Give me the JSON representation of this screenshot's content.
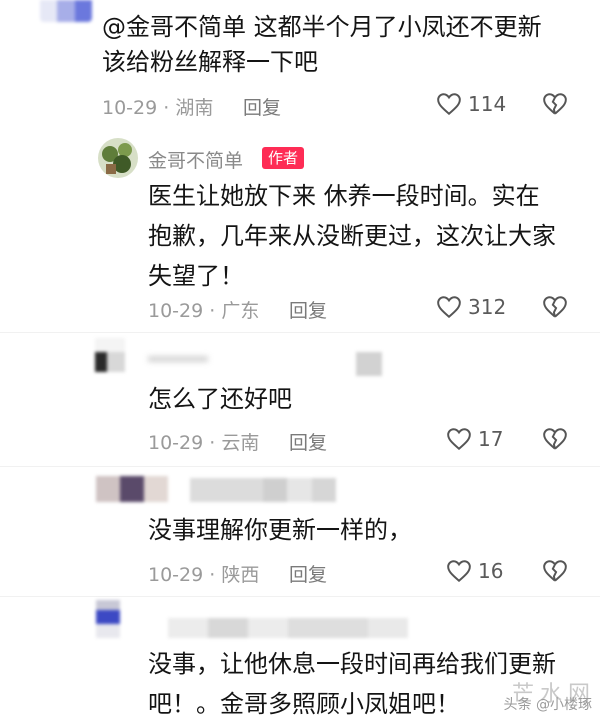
{
  "comments": [
    {
      "text_lines": [
        "@金哥不简单 这都半个月了小凤还不更新",
        "该给粉丝解释一下吧"
      ],
      "date": "10-29 · 湖南",
      "reply_label": "回复",
      "likes": "114"
    },
    {
      "nickname": "金哥不简单",
      "author_tag": "作者",
      "text_lines": [
        "医生让她放下来 休养一段时间。实在",
        "抱歉，几年来从没断更过，这次让大家",
        "失望了！"
      ],
      "date": "10-29 · 广东",
      "reply_label": "回复",
      "likes": "312"
    },
    {
      "text_lines": [
        "怎么了还好吧"
      ],
      "date": "10-29 · 云南",
      "reply_label": "回复",
      "likes": "17"
    },
    {
      "text_lines": [
        "没事理解你更新一样的，"
      ],
      "date": "10-29 · 陕西",
      "reply_label": "回复",
      "likes": "16"
    },
    {
      "text_lines": [
        "没事，让他休息一段时间再给我们更新",
        "吧！。金哥多照顾小凤姐吧！"
      ]
    }
  ],
  "watermark": "头条 @小楼琢",
  "site_logo": "芒水网",
  "icons": {
    "like": "heart-outline-icon",
    "dislike": "broken-heart-icon"
  },
  "colors": {
    "author_tag": "#fe2c55",
    "meta": "#9a9a9a"
  }
}
